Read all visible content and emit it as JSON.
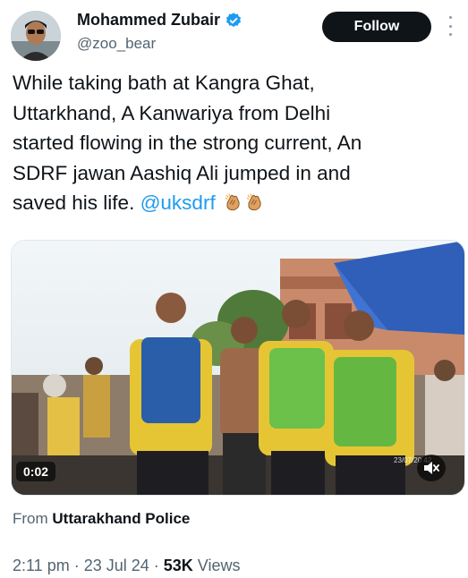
{
  "author": {
    "name": "Mohammed Zubair",
    "handle": "@zoo_bear"
  },
  "follow_label": "Follow",
  "tweet": {
    "text": "While taking bath at Kangra Ghat,\nUttarkhand, A Kanwariya from Delhi\nstarted flowing in the strong current, An\nSDRF jawan Aashiq Ali jumped in and\nsaved his life. ",
    "mention": "@uksdrf"
  },
  "media": {
    "duration": "0:02",
    "overlay_date": "23/07/20",
    "overlay_num": "42"
  },
  "source": {
    "prefix": "From ",
    "name": "Uttarakhand Police"
  },
  "meta": {
    "time": "2:11 pm",
    "separator": " · ",
    "date": "23 Jul 24",
    "views_count": "53K",
    "views_label": " Views"
  },
  "colors": {
    "link": "#1d9bf0",
    "verified": "#1d9bf0",
    "text": "#0f1419",
    "muted": "#536471"
  },
  "icons": [
    "verified-badge-icon",
    "more-icon",
    "clapping-hands-emoji",
    "mute-icon"
  ]
}
